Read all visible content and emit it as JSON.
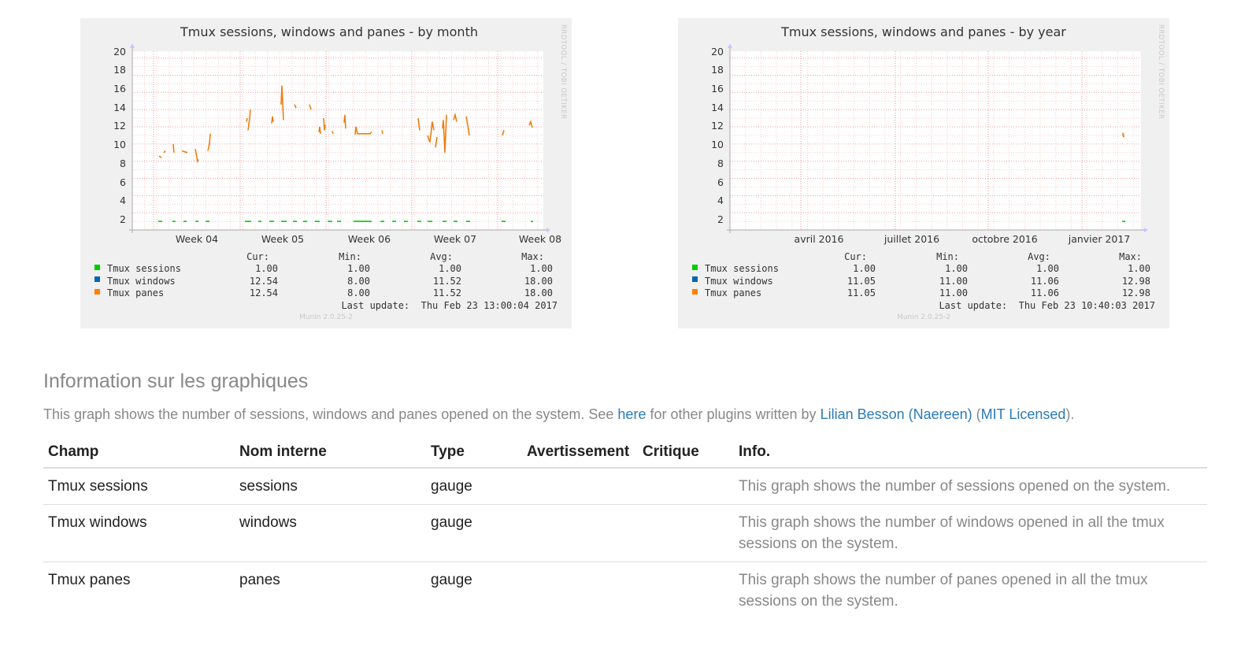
{
  "graphs": [
    {
      "id": "month",
      "title": "Tmux sessions, windows and panes - by month",
      "side_label": "RRDTOOL / TOBI OETIKER",
      "yticks": [
        "20",
        "18",
        "16",
        "14",
        "12",
        "10",
        "8",
        "6",
        "4",
        "2"
      ],
      "xticks": [
        "Week 04",
        "Week 05",
        "Week 06",
        "Week 07",
        "Week 08"
      ],
      "headers": {
        "cur": "Cur:",
        "min": "Min:",
        "avg": "Avg:",
        "max": "Max:"
      },
      "legend": [
        {
          "name": "Tmux sessions",
          "color": "#00cc00",
          "cur": "1.00",
          "min": "1.00",
          "avg": "1.00",
          "max": "1.00"
        },
        {
          "name": "Tmux windows",
          "color": "#0066b3",
          "cur": "12.54",
          "min": "8.00",
          "avg": "11.52",
          "max": "18.00"
        },
        {
          "name": "Tmux panes",
          "color": "#ff8000",
          "cur": "12.54",
          "min": "8.00",
          "avg": "11.52",
          "max": "18.00"
        }
      ],
      "last_update": "Last update:  Thu Feb 23 13:00:04 2017",
      "footer": "Munin 2.0.25-2"
    },
    {
      "id": "year",
      "title": "Tmux sessions, windows and panes - by year",
      "side_label": "RRDTOOL / TOBI OETIKER",
      "yticks": [
        "20",
        "18",
        "16",
        "14",
        "12",
        "10",
        "8",
        "6",
        "4",
        "2"
      ],
      "xticks": [
        "avril 2016",
        "juillet 2016",
        "octobre 2016",
        "janvier 2017"
      ],
      "headers": {
        "cur": "Cur:",
        "min": "Min:",
        "avg": "Avg:",
        "max": "Max:"
      },
      "legend": [
        {
          "name": "Tmux sessions",
          "color": "#00cc00",
          "cur": "1.00",
          "min": "1.00",
          "avg": "1.00",
          "max": "1.00"
        },
        {
          "name": "Tmux windows",
          "color": "#0066b3",
          "cur": "11.05",
          "min": "11.00",
          "avg": "11.06",
          "max": "12.98"
        },
        {
          "name": "Tmux panes",
          "color": "#ff8000",
          "cur": "11.05",
          "min": "11.00",
          "avg": "11.06",
          "max": "12.98"
        }
      ],
      "last_update": "Last update:  Thu Feb 23 10:40:03 2017",
      "footer": "Munin 2.0.25-2"
    }
  ],
  "info": {
    "title": "Information sur les graphiques",
    "desc_before": "This graph shows the number of sessions, windows and panes opened on the system. See ",
    "link_here": "here",
    "desc_mid": " for other plugins written by ",
    "link_author": "Lilian Besson (Naereen)",
    "paren_open": " (",
    "link_license": "MIT Licensed",
    "paren_close": ")."
  },
  "table": {
    "headers": {
      "champ": "Champ",
      "nom": "Nom interne",
      "type": "Type",
      "avert": "Avertissement",
      "crit": "Critique",
      "info": "Info."
    },
    "rows": [
      {
        "champ": "Tmux sessions",
        "nom": "sessions",
        "type": "gauge",
        "avert": "",
        "crit": "",
        "info": "This graph shows the number of sessions opened on the system."
      },
      {
        "champ": "Tmux windows",
        "nom": "windows",
        "type": "gauge",
        "avert": "",
        "crit": "",
        "info": "This graph shows the number of windows opened in all the tmux sessions on the system."
      },
      {
        "champ": "Tmux panes",
        "nom": "panes",
        "type": "gauge",
        "avert": "",
        "crit": "",
        "info": "This graph shows the number of panes opened in all the tmux sessions on the system."
      }
    ]
  }
}
